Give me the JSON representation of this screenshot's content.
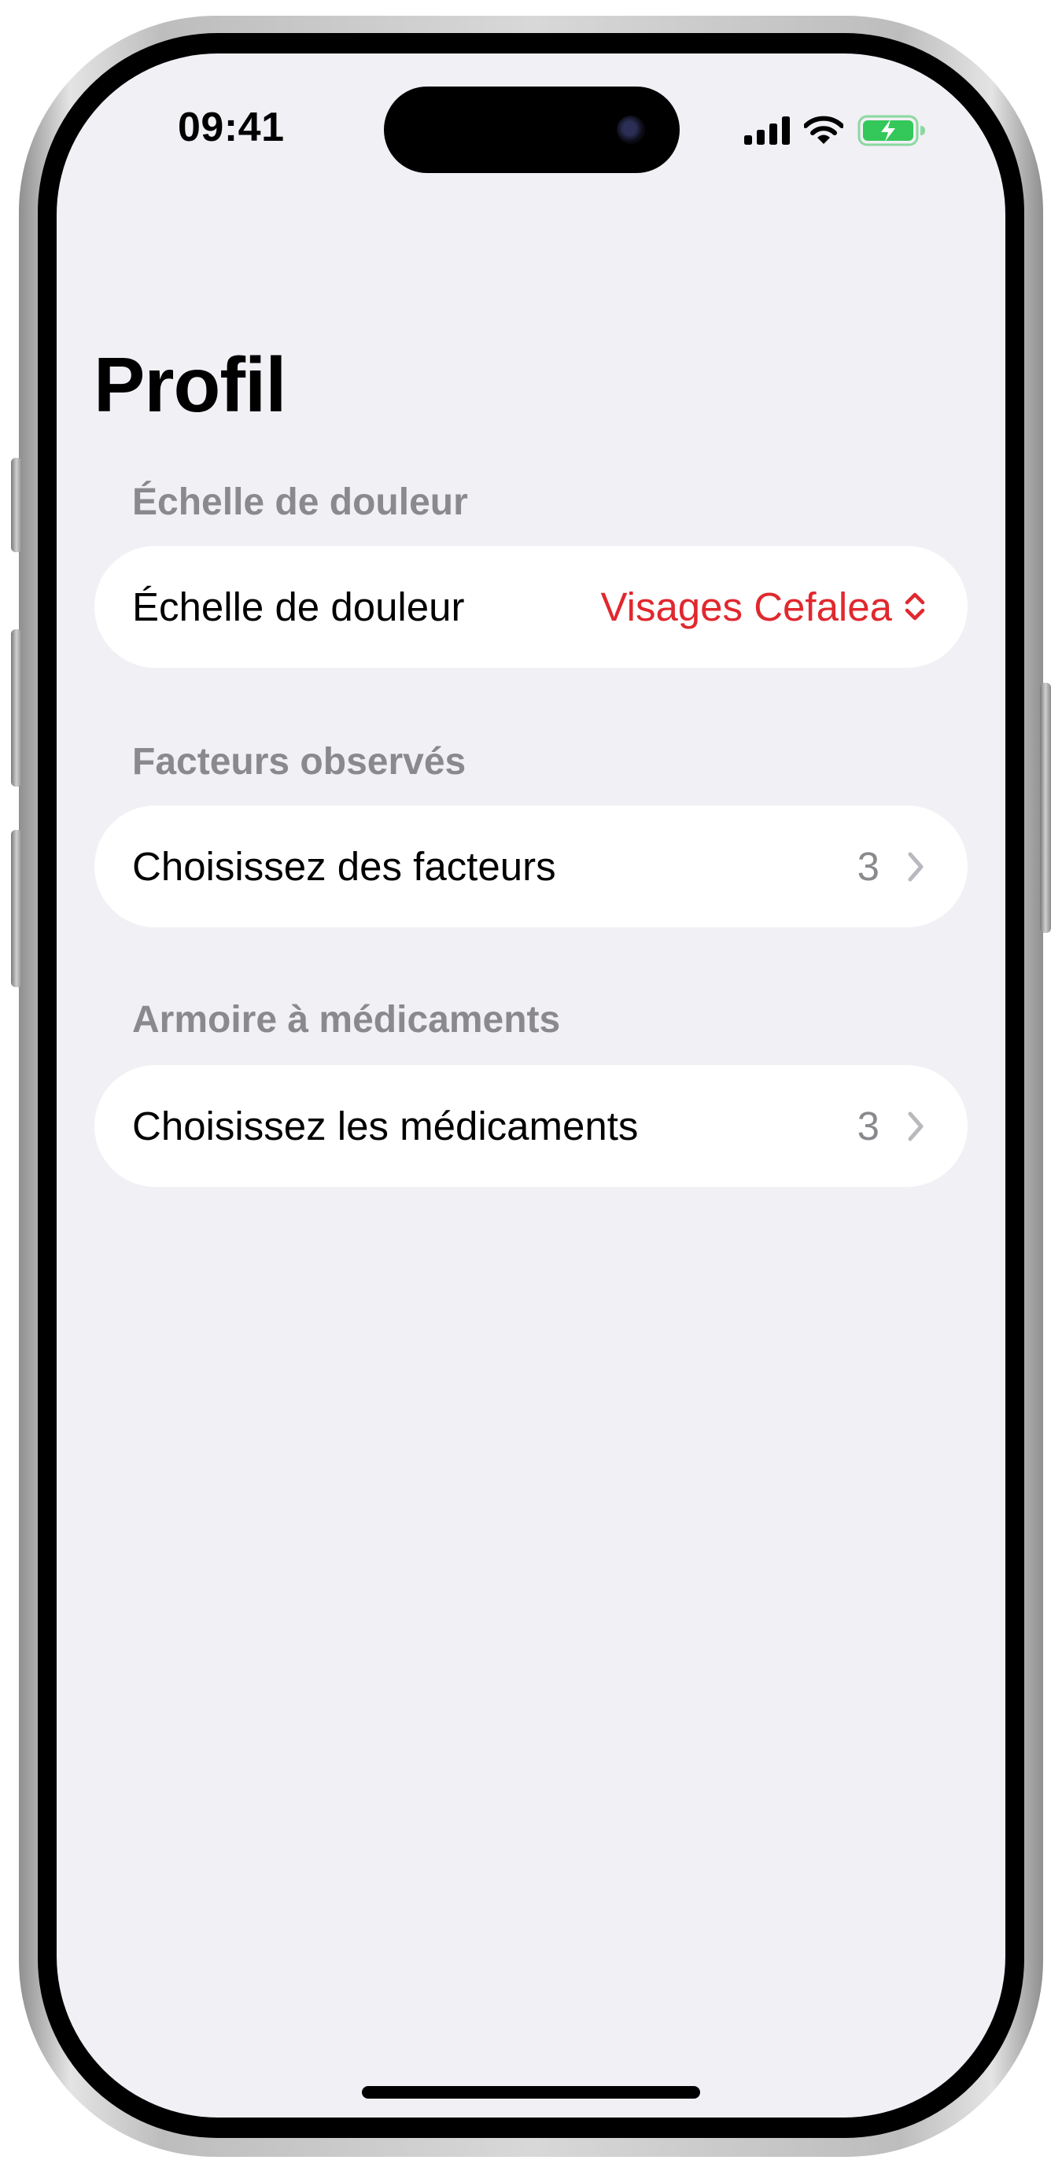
{
  "status_bar": {
    "time": "09:41",
    "icons": [
      "cellular-signal-icon",
      "wifi-icon",
      "battery-charging-icon"
    ]
  },
  "page": {
    "title": "Profil"
  },
  "sections": [
    {
      "header": "Échelle de douleur",
      "cell_label": "Échelle de douleur",
      "cell_value": "Visages Cefalea",
      "cell_icon": "up-down-chevron-icon"
    },
    {
      "header": "Facteurs observés",
      "cell_label": "Choisissez des facteurs",
      "cell_value": "3",
      "cell_icon": "chevron-right-icon"
    },
    {
      "header": "Armoire à médicaments",
      "cell_label": "Choisissez les médicaments",
      "cell_value": "3",
      "cell_icon": "chevron-right-icon"
    }
  ],
  "colors": {
    "accent": "#e0282e",
    "secondary_text": "#8a8a8e",
    "background": "#f1f0f5",
    "cell_background": "#ffffff",
    "battery": "#34c759"
  }
}
